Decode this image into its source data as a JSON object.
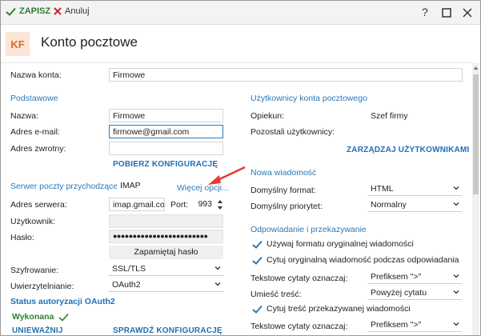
{
  "toolbar": {
    "save_label": "ZAPISZ",
    "cancel_label": "Anuluj"
  },
  "window_controls": {
    "help": "?"
  },
  "header": {
    "avatar_initials": "KF",
    "title": "Konto pocztowe"
  },
  "account": {
    "name_label": "Nazwa konta:",
    "name_value": "Firmowe"
  },
  "basic": {
    "section_title": "Podstawowe",
    "name_label": "Nazwa:",
    "name_value": "Firmowe",
    "email_label": "Adres e-mail:",
    "email_value": "firmowe@gmail.com",
    "reply_label": "Adres zwrotny:",
    "reply_value": "",
    "fetch_config_label": "POBIERZ KONFIGURACJĘ"
  },
  "users": {
    "section_title": "Użytkownicy konta pocztowego",
    "guardian_label": "Opiekun:",
    "guardian_value": "Szef firmy",
    "others_label": "Pozostali użytkownicy:",
    "manage_label": "ZARZĄDZAJ UŻYTKOWNIKAMI"
  },
  "incoming": {
    "section_title": "Serwer poczty przychodzącej:",
    "protocol": "IMAP",
    "more_options": "Więcej opcji...",
    "server_label": "Adres serwera:",
    "server_value": "imap.gmail.com",
    "port_label": "Port:",
    "port_value": "993",
    "user_label": "Użytkownik:",
    "user_value": "",
    "password_label": "Hasło:",
    "password_value": "●●●●●●●●●●●●●●●●●●●●●●●●",
    "remember_label": "Zapamiętaj hasło",
    "encryption_label": "Szyfrowanie:",
    "encryption_value": "SSL/TLS",
    "auth_label": "Uwierzytelnianie:",
    "auth_value": "OAuth2",
    "oauth_status_title": "Status autoryzacji OAuth2",
    "oauth_status_value": "Wykonana",
    "revoke_label": "UNIEWAŻNIJ",
    "check_config_label": "SPRAWDŹ KONFIGURACJĘ"
  },
  "new_message": {
    "section_title": "Nowa wiadomość",
    "format_label": "Domyślny format:",
    "format_value": "HTML",
    "priority_label": "Domyślny priorytet:",
    "priority_value": "Normalny"
  },
  "reply": {
    "section_title": "Odpowiadanie i przekazywanie",
    "use_original_format": "Używaj formatu oryginalnej wiadomości",
    "quote_original": "Cytuj oryginalną wiadomość podczas odpowiadania",
    "quote_mark_label": "Tekstowe cytaty oznaczaj:",
    "quote_mark_value": "Prefiksem \">\"",
    "place_label": "Umieść treść:",
    "place_value": "Powyżej cytatu",
    "quote_forwarded": "Cytuj treść przekazywanej wiadomości",
    "quote_mark2_label": "Tekstowe cytaty oznaczaj:",
    "quote_mark2_value": "Prefiksem \">\""
  },
  "colors": {
    "accent": "#2b78b5",
    "success": "#2e7d32",
    "danger": "#c62828",
    "avatar_bg": "#fbe5d6",
    "avatar_fg": "#d86b2c"
  }
}
